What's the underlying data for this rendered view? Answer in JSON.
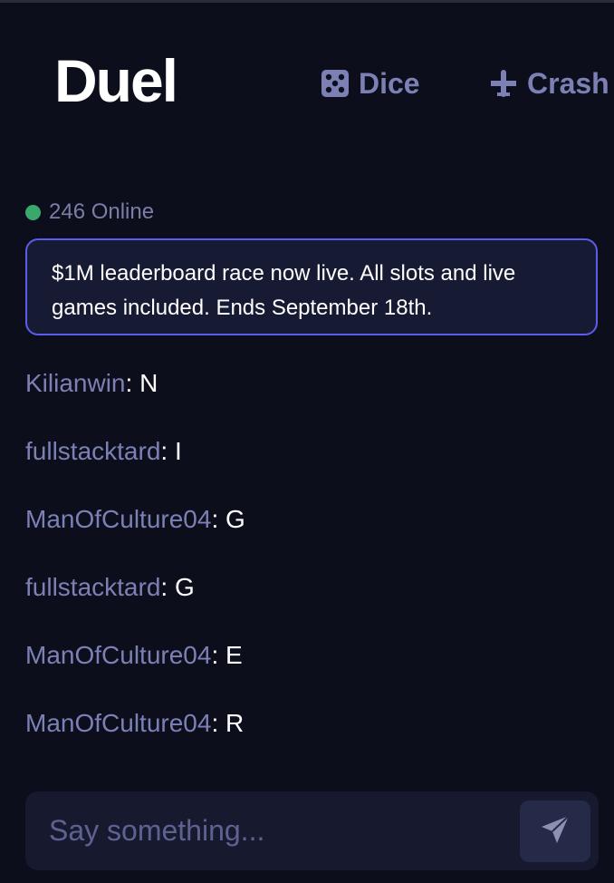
{
  "header": {
    "logo": "Duel",
    "nav": [
      {
        "label": "Dice",
        "icon": "dice-icon"
      },
      {
        "label": "Crash",
        "icon": "airplane-icon"
      }
    ]
  },
  "chat": {
    "online_text": "246 Online",
    "announcement": "$1M leaderboard race now live. All slots and live games included. Ends September 18th.",
    "messages": [
      {
        "user": "Kilianwin",
        "text": "N"
      },
      {
        "user": "fullstacktard",
        "text": "I"
      },
      {
        "user": "ManOfCulture04",
        "text": "G"
      },
      {
        "user": "fullstacktard",
        "text": "G"
      },
      {
        "user": "ManOfCulture04",
        "text": "E"
      },
      {
        "user": "ManOfCulture04",
        "text": "R"
      }
    ],
    "input": {
      "value": "",
      "placeholder": "Say something..."
    },
    "send_icon": "send-icon"
  },
  "colors": {
    "background": "#0c0e1c",
    "username": "#7c80b4",
    "online_dot": "#39a86a",
    "announcement_border": "#5b5ee8"
  }
}
